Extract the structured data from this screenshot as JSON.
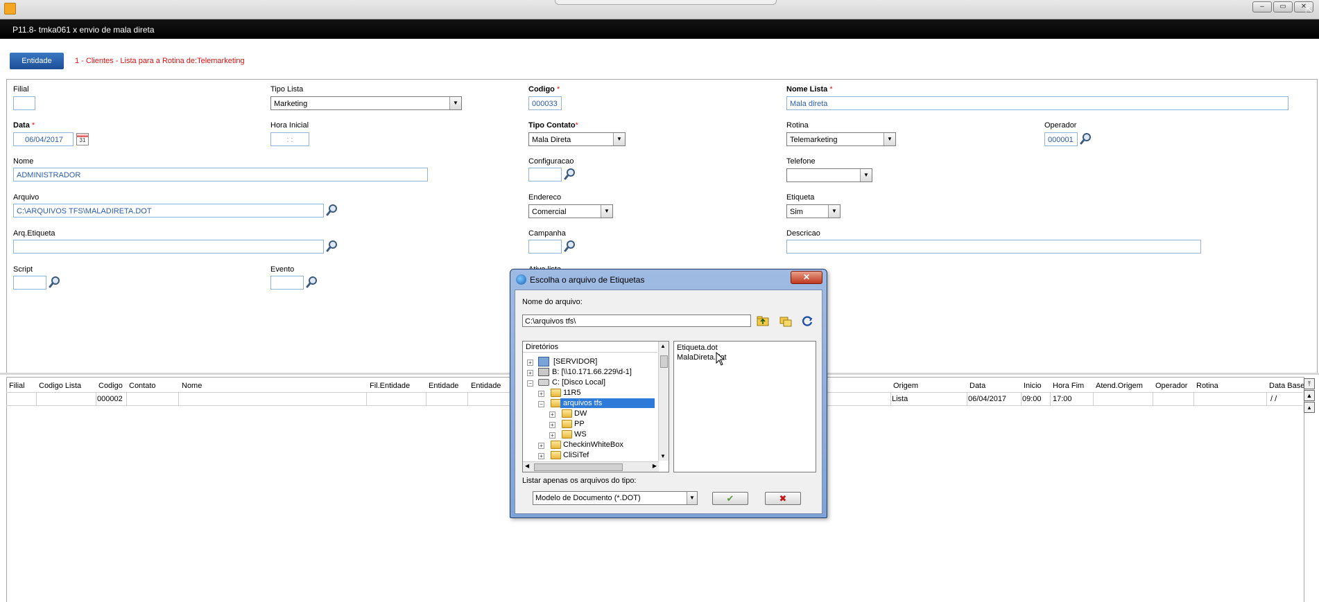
{
  "window": {
    "title": "P11.8- tmka061 x envio de mala direta",
    "controls": [
      "–",
      "▭",
      "✕"
    ]
  },
  "entity": {
    "button_label": "Entidade",
    "description": "1 - Clientes - Lista para a Rotina de:Telemarketing"
  },
  "form": {
    "filial": {
      "label": "Filial",
      "value": ""
    },
    "tipo_lista": {
      "label": "Tipo Lista",
      "value": "Marketing"
    },
    "codigo": {
      "label": "Codigo",
      "required": "*",
      "value": "000033"
    },
    "nome_lista": {
      "label": "Nome Lista",
      "required": "*",
      "value": "Mala direta"
    },
    "data": {
      "label": "Data",
      "required": "*",
      "value": "06/04/2017"
    },
    "hora_inicial": {
      "label": "Hora Inicial",
      "value": ": :"
    },
    "tipo_contato": {
      "label": "Tipo Contato",
      "required": "*",
      "value": "Mala Direta"
    },
    "rotina": {
      "label": "Rotina",
      "value": "Telemarketing"
    },
    "operador": {
      "label": "Operador",
      "value": "000001"
    },
    "nome": {
      "label": "Nome",
      "value": "ADMINISTRADOR"
    },
    "configuracao": {
      "label": "Configuracao",
      "value": ""
    },
    "telefone": {
      "label": "Telefone",
      "value": ""
    },
    "arquivo": {
      "label": "Arquivo",
      "value": "C:\\ARQUIVOS TFS\\MALADIRETA.DOT"
    },
    "endereco": {
      "label": "Endereco",
      "value": "Comercial"
    },
    "etiqueta": {
      "label": "Etiqueta",
      "value": "Sim"
    },
    "arq_etiqueta": {
      "label": "Arq.Etiqueta",
      "value": ""
    },
    "campanha": {
      "label": "Campanha",
      "value": ""
    },
    "descricao": {
      "label": "Descricao",
      "value": ""
    },
    "script": {
      "label": "Script",
      "value": ""
    },
    "evento": {
      "label": "Evento",
      "value": ""
    },
    "ativa_lista": {
      "label": "Ativa lista"
    }
  },
  "grid": {
    "headers": [
      "Filial",
      "Codigo Lista",
      "Codigo",
      "Contato",
      "Nome",
      "Fil.Entidade",
      "Entidade",
      "Entidade",
      "Origem",
      "Data",
      "Inicio",
      "Hora Fim",
      "Atend.Origem",
      "Operador",
      "Rotina",
      "Data Base"
    ],
    "row": {
      "codigo": "000002",
      "origem": "Lista",
      "data": "06/04/2017",
      "inicio": "09:00",
      "hora_fim": "17:00",
      "data_base": "/ /"
    }
  },
  "dialog": {
    "title": "Escolha o arquivo de Etiquetas",
    "close_label": "✕",
    "filename_label": "Nome do arquivo:",
    "path": "C:\\arquivos tfs\\",
    "dirs_label": "Diretórios",
    "tree": [
      {
        "label": "[SERVIDOR]"
      },
      {
        "label": "B: [\\\\10.171.66.229\\d-1]"
      },
      {
        "label": "C: [Disco Local]"
      },
      {
        "label": "11R5"
      },
      {
        "label": "arquivos tfs"
      },
      {
        "label": "DW"
      },
      {
        "label": "PP"
      },
      {
        "label": "WS"
      },
      {
        "label": "CheckinWhiteBox"
      },
      {
        "label": "CliSiTef"
      }
    ],
    "files": [
      "Etiqueta.dot",
      "MalaDireta.dot"
    ],
    "type_label": "Listar apenas os arquivos do tipo:",
    "type_value": "Modelo de Documento (*.DOT)",
    "ok_label": "✔",
    "cancel_label": "✖"
  }
}
